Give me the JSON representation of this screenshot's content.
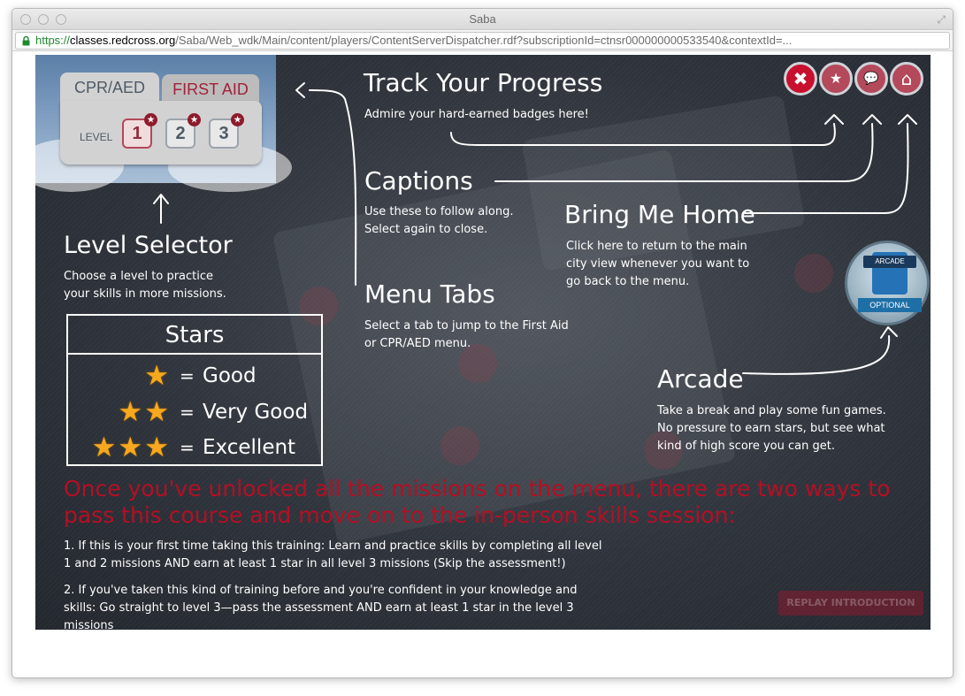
{
  "window": {
    "title": "Saba"
  },
  "address_bar": {
    "scheme": "https://",
    "host": "classes.redcross.org",
    "path": "/Saba/Web_wdk/Main/content/players/ContentServerDispatcher.rdf?subscriptionId=ctnsr000000000533540&contextId=..."
  },
  "level_panel": {
    "tabs": [
      {
        "label": "CPR/AED"
      },
      {
        "label": "FIRST AID"
      }
    ],
    "level_label": "LEVEL",
    "levels": [
      "1",
      "2",
      "3"
    ]
  },
  "callouts": {
    "track_progress": {
      "title": "Track Your Progress",
      "body": "Admire your hard-earned badges here!"
    },
    "captions": {
      "title": "Captions",
      "body": "Use these to follow along. Select again to close."
    },
    "bring_home": {
      "title": "Bring Me Home",
      "body": "Click here to return to the main city view whenever you want to go back to the menu."
    },
    "level_selector": {
      "title": "Level Selector",
      "body": "Choose a level to practice your skills in more missions."
    },
    "menu_tabs": {
      "title": "Menu Tabs",
      "body": "Select a tab to jump to the First Aid or CPR/AED menu."
    },
    "arcade": {
      "title": "Arcade",
      "body": "Take a break and play some fun games. No pressure to earn stars, but see what kind of high score you can get."
    }
  },
  "stars_table": {
    "title": "Stars",
    "rows": [
      {
        "stars": "★",
        "eq": "=",
        "label": "Good"
      },
      {
        "stars": "★★",
        "eq": "=",
        "label": "Very Good"
      },
      {
        "stars": "★★★",
        "eq": "=",
        "label": "Excellent"
      }
    ]
  },
  "top_buttons": {
    "close": "✖",
    "badges": "★",
    "captions": "💬",
    "home": "⌂"
  },
  "arcade_badge": {
    "label": "ARCADE",
    "optional": "OPTIONAL"
  },
  "notice": "Once you've unlocked all the missions on the menu, there are two ways to pass this course and move on to the in-person skills session:",
  "instructions": [
    "1. If this is your first time taking this training: Learn and practice skills by completing all level 1 and 2 missions AND earn at least 1 star in all level 3 missions (Skip the assessment!)",
    "2. If you've taken this kind of training before and you're confident in your knowledge and skills: Go straight to level 3—pass the assessment AND earn at least 1 star in the level 3 missions"
  ],
  "replay_button": "REPLAY INTRODUCTION",
  "colors": {
    "accent_red": "#b40f24",
    "star_gold": "#f6a81f",
    "url_green": "#1e8a2e"
  }
}
